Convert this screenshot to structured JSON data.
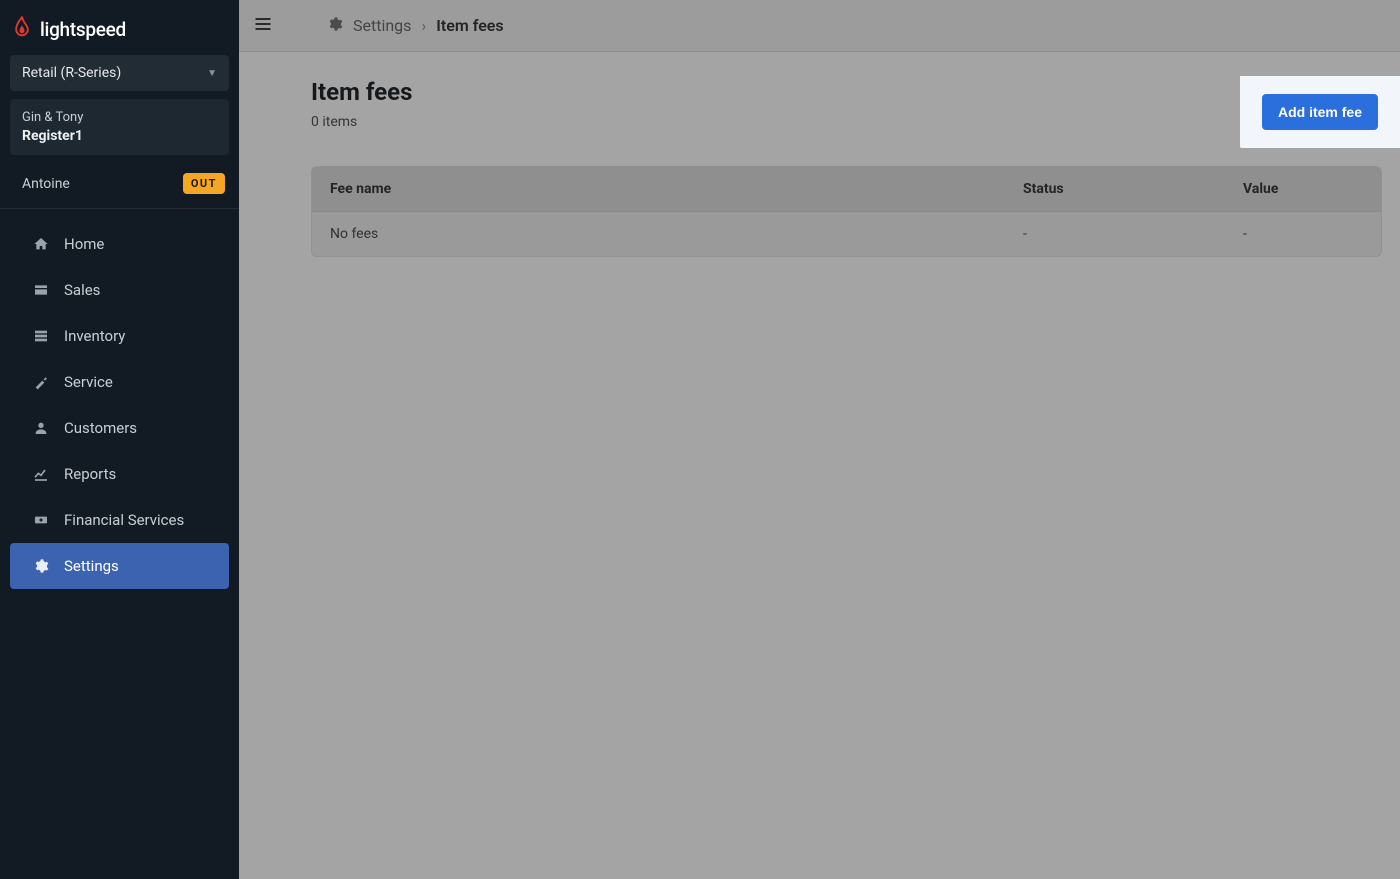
{
  "brand": {
    "name": "lightspeed"
  },
  "sidebar": {
    "series_label": "Retail (R-Series)",
    "merchant_name": "Gin & Tony",
    "register_label": "Register1",
    "user_name": "Antoine",
    "out_badge": "OUT",
    "items": [
      {
        "key": "home",
        "label": "Home",
        "icon": "home-icon"
      },
      {
        "key": "sales",
        "label": "Sales",
        "icon": "sales-icon"
      },
      {
        "key": "inventory",
        "label": "Inventory",
        "icon": "inventory-icon"
      },
      {
        "key": "service",
        "label": "Service",
        "icon": "service-icon"
      },
      {
        "key": "customers",
        "label": "Customers",
        "icon": "customers-icon"
      },
      {
        "key": "reports",
        "label": "Reports",
        "icon": "reports-icon"
      },
      {
        "key": "financial",
        "label": "Financial Services",
        "icon": "financial-icon"
      },
      {
        "key": "settings",
        "label": "Settings",
        "icon": "gear-icon"
      }
    ],
    "active_index": 7
  },
  "breadcrumbs": {
    "root_label": "Settings",
    "current_label": "Item fees"
  },
  "page": {
    "title": "Item fees",
    "count_text": "0 items",
    "add_button_label": "Add item fee"
  },
  "table": {
    "columns": {
      "fee_name": "Fee name",
      "status": "Status",
      "value": "Value"
    },
    "empty_row": {
      "fee_name": "No fees",
      "status": "-",
      "value": "-"
    }
  }
}
